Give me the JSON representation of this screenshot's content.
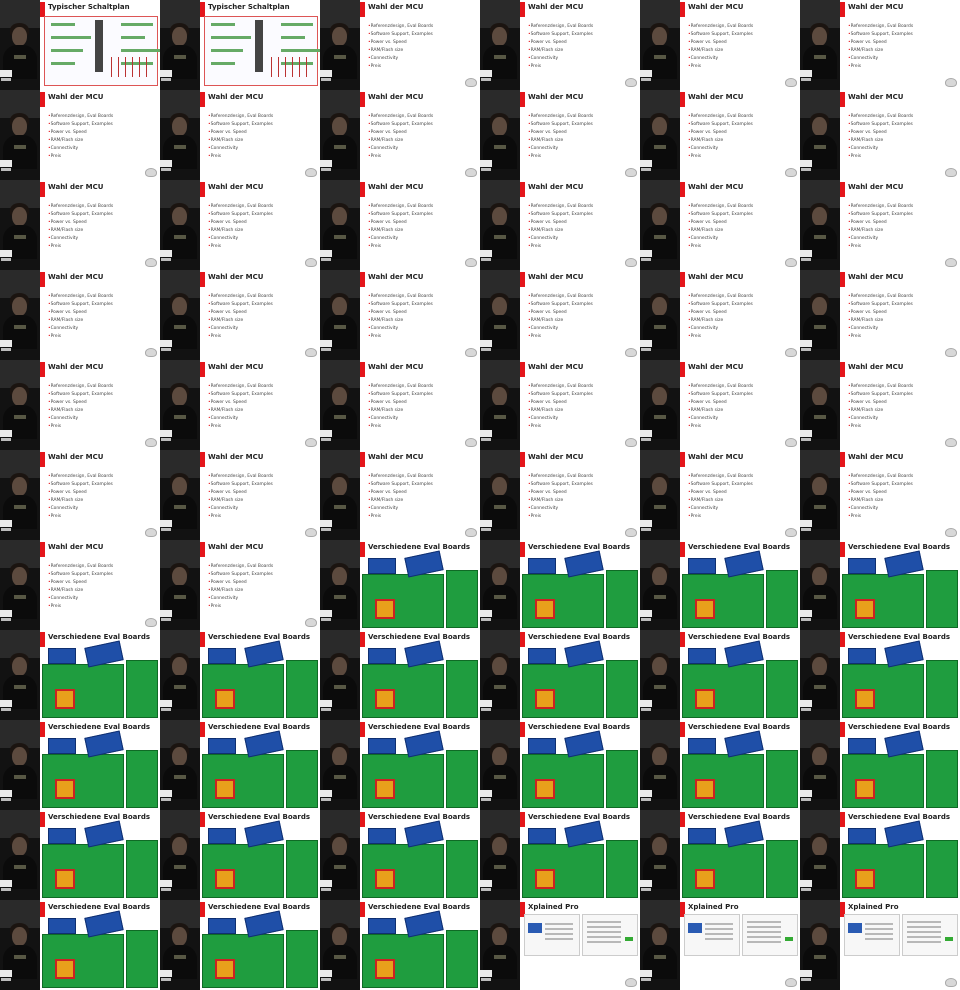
{
  "slides": {
    "schaltplan": {
      "title": "Typischer Schaltplan"
    },
    "mcu": {
      "title": "Wahl der MCU",
      "bullets": [
        "Referenzdesign, Eval Boards",
        "Software Support, Examples",
        "Power vs. Speed",
        "RAM/Flash size",
        "Connectivity",
        "Preis"
      ]
    },
    "eval": {
      "title": "Verschiedene Eval Boards"
    },
    "xplained": {
      "title": "Xplained Pro"
    }
  },
  "sequence": [
    "schaltplan",
    "schaltplan",
    "mcu",
    "mcu",
    "mcu",
    "mcu",
    "mcu",
    "mcu",
    "mcu",
    "mcu",
    "mcu",
    "mcu",
    "mcu",
    "mcu",
    "mcu",
    "mcu",
    "mcu",
    "mcu",
    "mcu",
    "mcu",
    "mcu",
    "mcu",
    "mcu",
    "mcu",
    "mcu",
    "mcu",
    "mcu",
    "mcu",
    "mcu",
    "mcu",
    "mcu",
    "mcu",
    "mcu",
    "mcu",
    "mcu",
    "mcu",
    "mcu",
    "mcu",
    "eval",
    "eval",
    "eval",
    "eval",
    "eval",
    "eval",
    "eval",
    "eval",
    "eval",
    "eval",
    "eval",
    "eval",
    "eval",
    "eval",
    "eval",
    "eval",
    "eval",
    "eval",
    "eval",
    "eval",
    "eval",
    "eval",
    "eval",
    "eval",
    "eval",
    "xplained",
    "xplained",
    "xplained"
  ],
  "colors": {
    "accent": "#e4161b",
    "board_green": "#1f9d3f",
    "board_blue": "#1f4fa8"
  }
}
